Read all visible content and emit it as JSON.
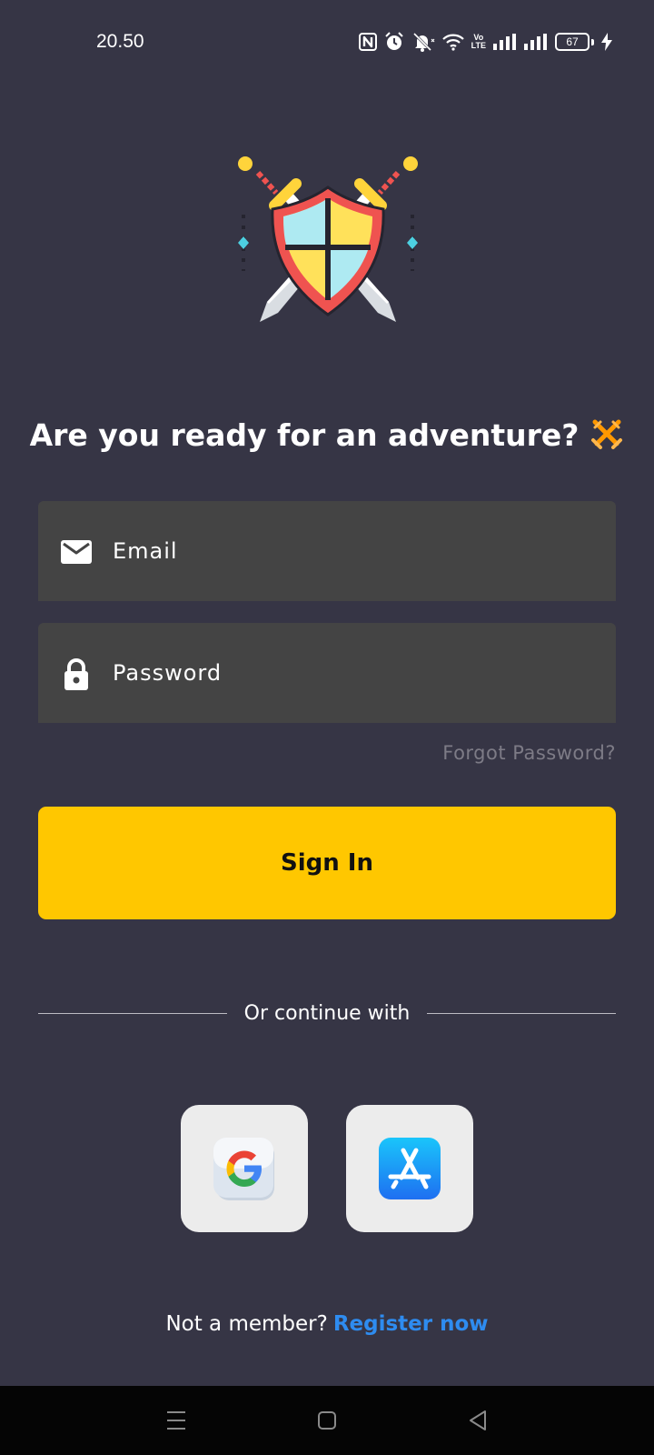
{
  "status_bar": {
    "time": "20.50",
    "volte_top": "Vo",
    "volte_bottom": "LTE",
    "battery": "67",
    "icons": [
      "nfc-icon",
      "alarm-icon",
      "mute-icon",
      "wifi-icon",
      "volte-icon",
      "signal-icon",
      "signal-icon",
      "battery-icon",
      "charging-icon"
    ]
  },
  "logo": "crossed-swords-shield-logo",
  "heading": {
    "text": "Are you ready for an adventure?",
    "emoji": "crossed-swords-emoji"
  },
  "form": {
    "email_placeholder": "Email",
    "password_placeholder": "Password",
    "email_icon": "mail-icon",
    "password_icon": "lock-icon",
    "forgot_password": "Forgot Password?",
    "signin_label": "Sign In"
  },
  "divider_text": "Or continue with",
  "social": [
    {
      "name": "google",
      "icon": "google-icon"
    },
    {
      "name": "app-store",
      "icon": "app-store-icon"
    }
  ],
  "register": {
    "prompt": "Not a member?",
    "link": "Register now"
  },
  "colors": {
    "background": "#363545",
    "field": "#444444",
    "accent": "#ffc700",
    "link": "#2e8cf0",
    "muted": "#7d7b86"
  },
  "navigation": [
    "menu-icon",
    "home-icon",
    "back-icon"
  ]
}
